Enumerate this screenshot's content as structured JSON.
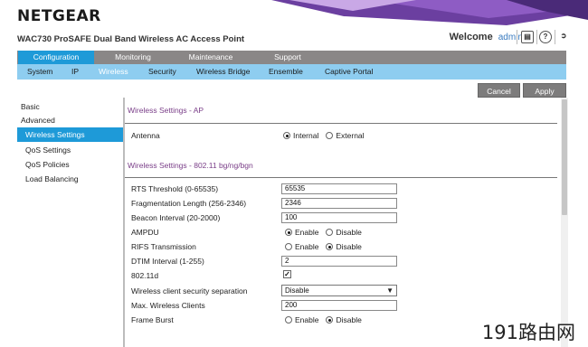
{
  "brand": {
    "logo_text": "NETGEAR",
    "product_title": "WAC730 ProSAFE Dual Band Wireless AC Access Point"
  },
  "header": {
    "welcome_label": "Welcome",
    "username": "admin"
  },
  "colors": {
    "accent": "#1e9ad8",
    "tab_bar": "#8a8787",
    "sub_nav": "#8ecdf0",
    "section_title": "#7a3e88",
    "header_decor": "#6b3fa0"
  },
  "main_tabs": [
    {
      "label": "Configuration",
      "active": true
    },
    {
      "label": "Monitoring",
      "active": false
    },
    {
      "label": "Maintenance",
      "active": false
    },
    {
      "label": "Support",
      "active": false
    }
  ],
  "sub_nav": [
    {
      "label": "System",
      "active": false
    },
    {
      "label": "IP",
      "active": false
    },
    {
      "label": "Wireless",
      "active": true
    },
    {
      "label": "Security",
      "active": false
    },
    {
      "label": "Wireless Bridge",
      "active": false
    },
    {
      "label": "Ensemble",
      "active": false
    },
    {
      "label": "Captive Portal",
      "active": false
    }
  ],
  "actions": {
    "cancel_label": "Cancel",
    "apply_label": "Apply"
  },
  "side_menu": [
    {
      "label": "Basic",
      "active": false
    },
    {
      "label": "Advanced",
      "active": false
    },
    {
      "label": "Wireless Settings",
      "active": true
    },
    {
      "label": "QoS Settings",
      "active": false
    },
    {
      "label": "QoS Policies",
      "active": false
    },
    {
      "label": "Load Balancing",
      "active": false
    }
  ],
  "section_ap": {
    "title": "Wireless Settings - AP",
    "antenna": {
      "label": "Antenna",
      "options": [
        "Internal",
        "External"
      ],
      "selected": "Internal"
    }
  },
  "section_radio": {
    "title": "Wireless Settings - 802.11 bg/ng/bgn",
    "rts_threshold": {
      "label": "RTS Threshold (0-65535)",
      "value": "65535"
    },
    "fragmentation": {
      "label": "Fragmentation Length (256-2346)",
      "value": "2346"
    },
    "beacon_interval": {
      "label": "Beacon Interval (20-2000)",
      "value": "100"
    },
    "ampdu": {
      "label": "AMPDU",
      "options": [
        "Enable",
        "Disable"
      ],
      "selected": "Enable"
    },
    "rifs": {
      "label": "RIFS Transmission",
      "options": [
        "Enable",
        "Disable"
      ],
      "selected": "Disable"
    },
    "dtim_interval": {
      "label": "DTIM Interval (1-255)",
      "value": "2"
    },
    "dot11d": {
      "label": "802.11d",
      "checked": true
    },
    "client_separation": {
      "label": "Wireless client security separation",
      "value": "Disable"
    },
    "max_clients": {
      "label": "Max. Wireless Clients",
      "value": "200"
    },
    "frame_burst": {
      "label": "Frame Burst",
      "options": [
        "Enable",
        "Disable"
      ],
      "selected": "Disable"
    }
  },
  "icons": {
    "logout": "logout-icon",
    "help": "help-icon",
    "document": "document-icon"
  },
  "watermark": {
    "text": "191路由网"
  }
}
